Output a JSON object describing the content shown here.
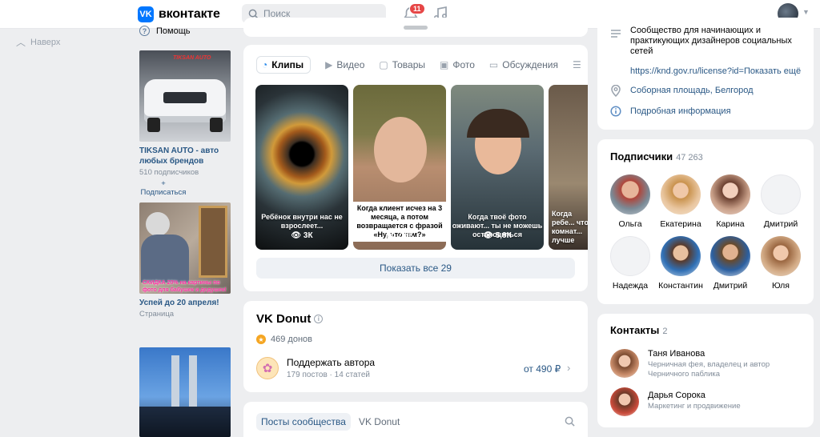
{
  "header": {
    "logo_mark": "VK",
    "logo_text": "вконтакте",
    "search_placeholder": "Поиск",
    "notification_count": "11"
  },
  "left_nav": {
    "back_to_top": "Наверх"
  },
  "ads": {
    "help_label": "Помощь",
    "items": [
      {
        "title": "TIKSAN AUTO - авто любых брендов",
        "meta": "510 подписчиков",
        "action": "+ Подписаться",
        "img_text": "TIKSAN AUTO"
      },
      {
        "title": "Успей до 20 апреля!",
        "meta": "Страница",
        "action": "",
        "img_text": "СКИДКА 20% на картины по фото для бабушек и дедушек!"
      },
      {
        "title": "",
        "meta": "",
        "action": "",
        "img_text": ""
      }
    ]
  },
  "media_tabs": [
    {
      "label": "Клипы",
      "icon": "clip-icon"
    },
    {
      "label": "Видео",
      "icon": "video-icon"
    },
    {
      "label": "Товары",
      "icon": "bag-icon"
    },
    {
      "label": "Фото",
      "icon": "photo-icon"
    },
    {
      "label": "Обсуждения",
      "icon": "chat-icon"
    }
  ],
  "clips": [
    {
      "caption": "Ребёнок внутри нас не взрослеет...",
      "views": "3К"
    },
    {
      "caption": "Когда клиент исчез на 3 месяца, а потом возвращается с фразой «Ну, что там?»",
      "views": "7,6К"
    },
    {
      "caption": "Когда твоё фото оживают... ты не можешь остановиться",
      "views": "5,9К"
    },
    {
      "caption": "Когда ребе... что в комнат... лучше",
      "views": ""
    }
  ],
  "show_all": "Показать все 29",
  "donut": {
    "title": "VK Donut",
    "donors": "469 донов",
    "support_title": "Поддержать автора",
    "support_meta": "179 постов · 14 статей",
    "price": "от 490 ₽"
  },
  "posts_tabs": [
    "Посты сообщества",
    "VK Donut"
  ],
  "info": {
    "description": "Сообщество для начинающих и практикующих дизайнеров социальных сетей",
    "link": "https://knd.gov.ru/license?id=Показать ещё",
    "location": "Соборная площадь, Белгород",
    "more": "Подробная информация"
  },
  "subscribers": {
    "title": "Подписчики",
    "count": "47 263",
    "people": [
      "Ольга",
      "Екатерина",
      "Карина",
      "Дмитрий",
      "Надежда",
      "Константин",
      "Дмитрий",
      "Юля"
    ]
  },
  "contacts": {
    "title": "Контакты",
    "count": "2",
    "people": [
      {
        "name": "Таня Иванова",
        "role": "Черничная фея, владелец и автор Черничного паблика"
      },
      {
        "name": "Дарья Сорока",
        "role": "Маркетинг и продвижение"
      }
    ]
  },
  "colors": {
    "accent": "#0077ff",
    "link": "#2a5885",
    "badge": "#e64646",
    "bg": "#edeef0"
  }
}
